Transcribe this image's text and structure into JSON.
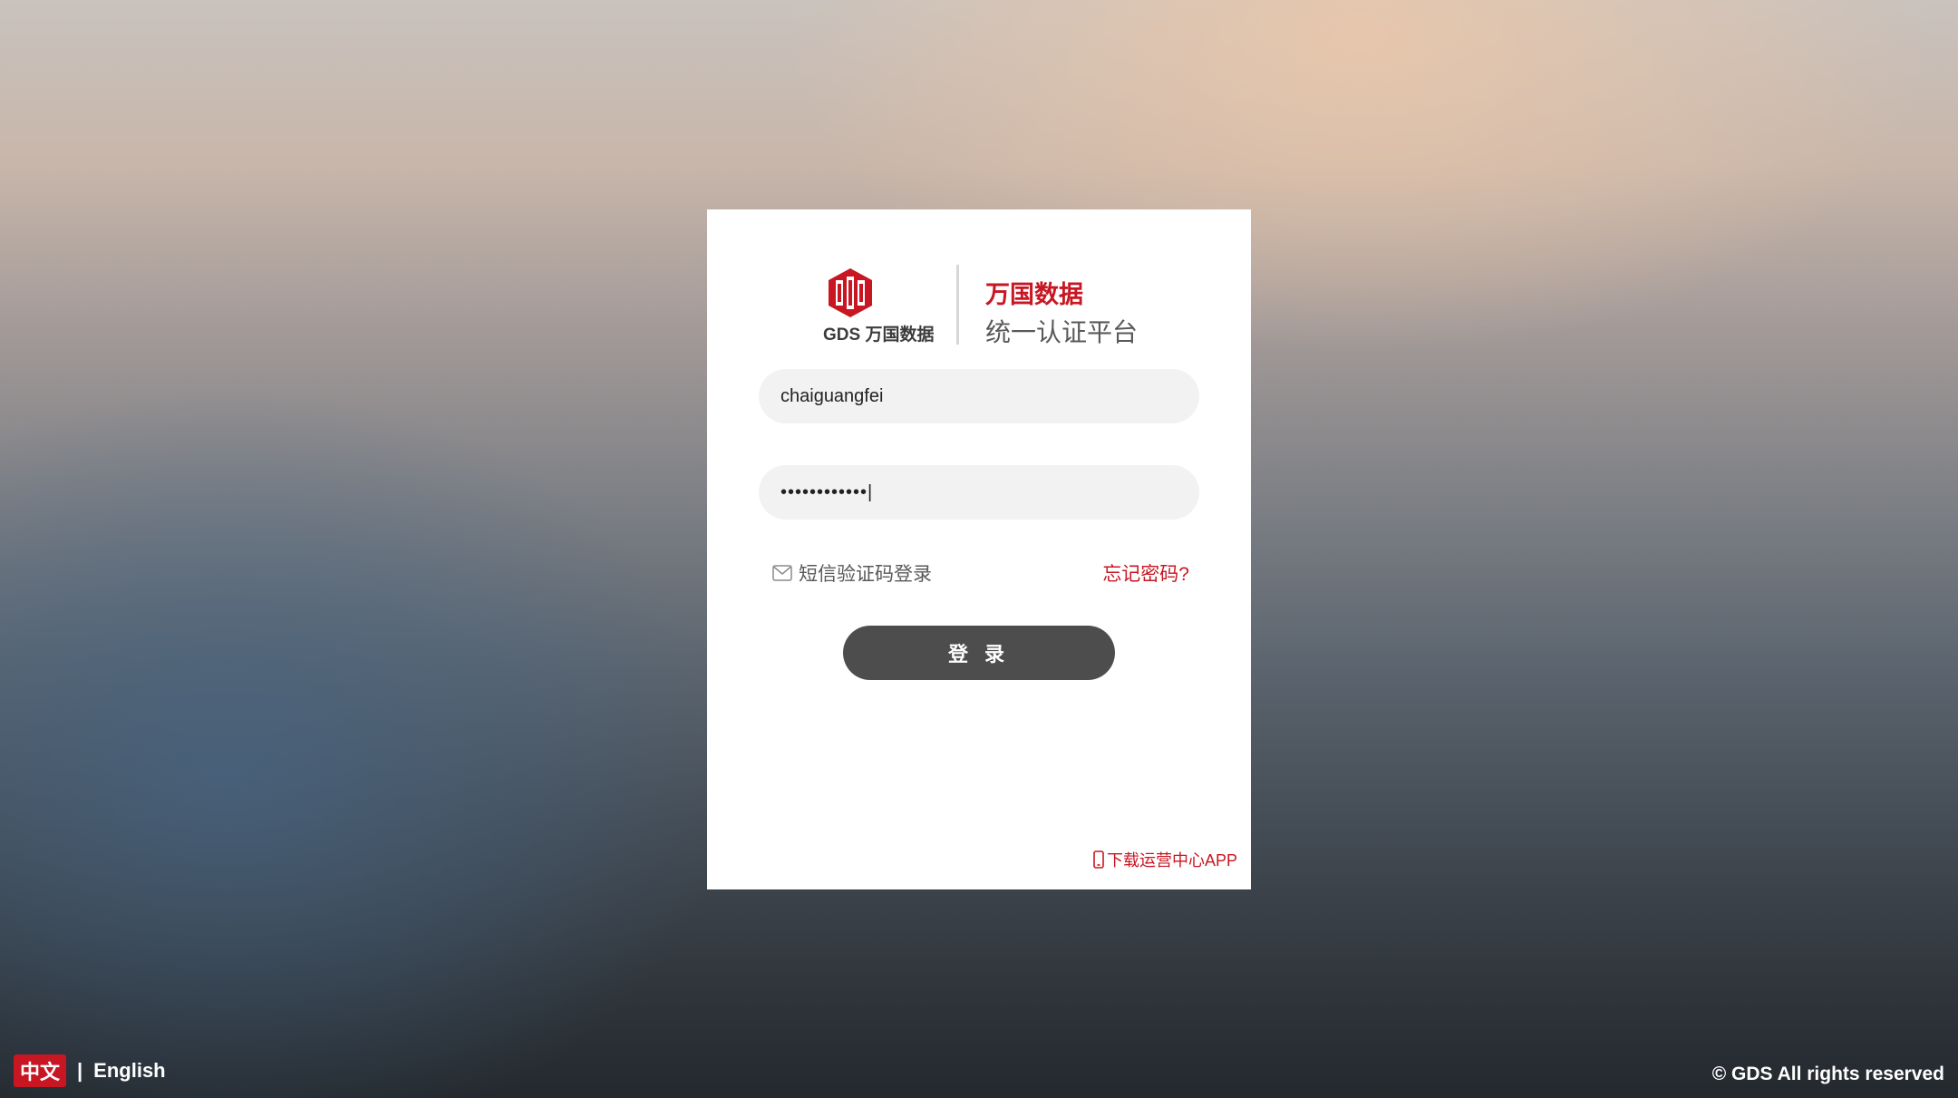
{
  "brand": {
    "logo_text": "GDS 万国数据",
    "name": "万国数据",
    "subtitle": "统一认证平台"
  },
  "form": {
    "username_value": "chaiguangfei",
    "password_value": "••••••••••••|",
    "sms_login_label": "短信验证码登录",
    "forgot_label": "忘记密码?",
    "login_button_label": "登 录"
  },
  "footer": {
    "app_download_label": "下载运营中心APP",
    "lang_zh": "中文",
    "lang_separator": "|",
    "lang_en": "English",
    "copyright": "© GDS All rights reserved"
  },
  "colors": {
    "brand_red": "#c81623",
    "button_gray": "#4d4d4d",
    "field_bg": "#f2f2f2"
  },
  "icons": {
    "sms": "mail-icon",
    "app": "phone-icon",
    "logo": "gds-logo-icon"
  }
}
